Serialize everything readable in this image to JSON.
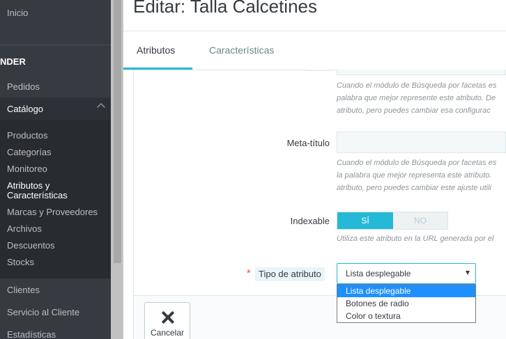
{
  "sidebar": {
    "top_item": "Inicio",
    "section": "NDER",
    "orders": "Pedidos",
    "catalog": "Catálogo",
    "sub_items": [
      "Productos",
      "Categorías",
      "Monitoreo",
      "Atributos y",
      "Características",
      "Marcas y Proveedores",
      "Archivos",
      "Descuentos",
      "Stocks"
    ],
    "customers": "Clientes",
    "customer_service": "Servicio al Cliente",
    "stats": "Estadísticas"
  },
  "header": {
    "title": "Editar: Talla Calcetines"
  },
  "tabs": [
    {
      "label": "Atributos"
    },
    {
      "label": "Características"
    }
  ],
  "form": {
    "help1": [
      "Cuando el módulo de Búsqueda por facetas es",
      "palabra que mejor represente este atributo. De",
      "atributo, pero puedes cambiar esa configurac"
    ],
    "meta_title_label": "Meta-título",
    "meta_title_value": "",
    "help2": [
      "Cuando el módulo de Búsqueda por facetas es",
      "la palabra que mejor representa este atributo.",
      "atributo, pero puedes cambiar este ajuste utili"
    ],
    "indexable_label": "Indexable",
    "switch_yes": "SÍ",
    "switch_no": "NO",
    "help3": "Utiliza este atributo en la URL generada por el",
    "required_mark": "*",
    "type_label": "Tipo de atributo",
    "type_selected": "Lista desplegable",
    "type_options": [
      "Lista desplegable",
      "Botones de radio",
      "Color o textura"
    ]
  },
  "footer": {
    "cancel_label": "Cancelar"
  },
  "colors": {
    "accent": "#25b9d7",
    "sidebar": "#363a41",
    "required": "#f54c3e"
  }
}
